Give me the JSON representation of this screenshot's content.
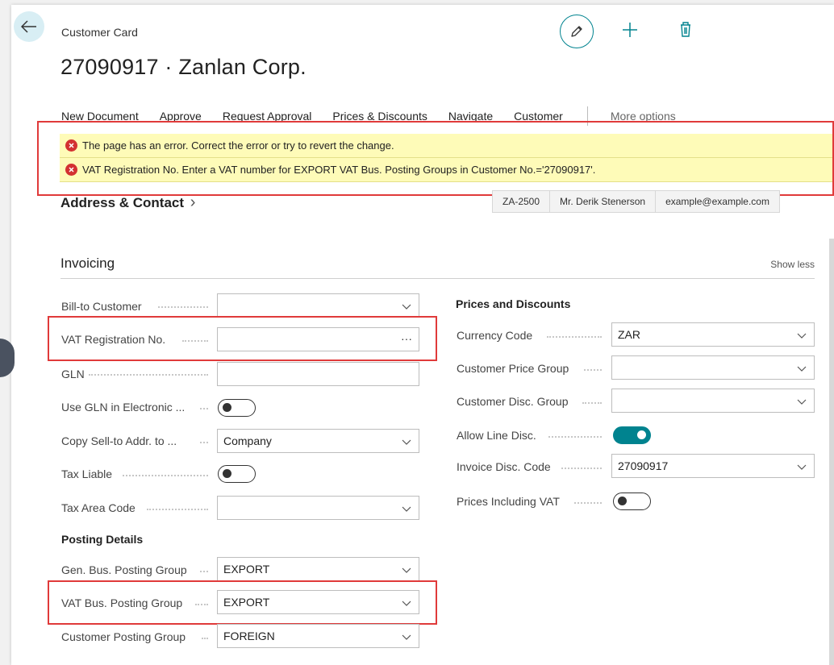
{
  "header": {
    "breadcrumb": "Customer Card",
    "title": "27090917 · Zanlan Corp."
  },
  "actions": {
    "items": [
      "New Document",
      "Approve",
      "Request Approval",
      "Prices & Discounts",
      "Navigate",
      "Customer"
    ],
    "more": "More options"
  },
  "errors": [
    "The page has an error. Correct the error or try to revert the change.",
    "VAT Registration No. Enter a VAT number for EXPORT VAT Bus. Posting Groups in Customer No.='27090917'."
  ],
  "address": {
    "title": "Address & Contact",
    "chevron": "›",
    "post_code": "ZA-2500",
    "contact": "Mr. Derik Stenerson",
    "email": "example@example.com"
  },
  "invoicing": {
    "title": "Invoicing",
    "show_less": "Show less",
    "left": {
      "bill_to_label": "Bill-to Customer",
      "bill_to_value": "",
      "vat_reg_label": "VAT Registration No.",
      "vat_reg_value": "",
      "vat_reg_more": "···",
      "gln_label": "GLN",
      "gln_value": "",
      "use_gln_label": "Use GLN in Electronic ...",
      "use_gln_on": false,
      "copy_sell_label": "Copy Sell-to Addr. to ...",
      "copy_sell_value": "Company",
      "tax_liable_label": "Tax Liable",
      "tax_liable_on": false,
      "tax_area_label": "Tax Area Code",
      "tax_area_value": ""
    },
    "posting": {
      "title": "Posting Details",
      "gen_bus_label": "Gen. Bus. Posting Group",
      "gen_bus_value": "EXPORT",
      "vat_bus_label": "VAT Bus. Posting Group",
      "vat_bus_value": "EXPORT",
      "cust_posting_label": "Customer Posting Group",
      "cust_posting_value": "FOREIGN"
    },
    "right": {
      "title": "Prices and Discounts",
      "currency_label": "Currency Code",
      "currency_value": "ZAR",
      "price_group_label": "Customer Price Group",
      "price_group_value": "",
      "disc_group_label": "Customer Disc. Group",
      "disc_group_value": "",
      "allow_line_label": "Allow Line Disc.",
      "allow_line_on": true,
      "inv_disc_label": "Invoice Disc. Code",
      "inv_disc_value": "27090917",
      "prices_vat_label": "Prices Including VAT",
      "prices_vat_on": false
    }
  },
  "colors": {
    "accent": "#00838f",
    "error_bg": "#fefbb8",
    "error_icon": "#d33131",
    "highlight": "#e03a3a"
  }
}
